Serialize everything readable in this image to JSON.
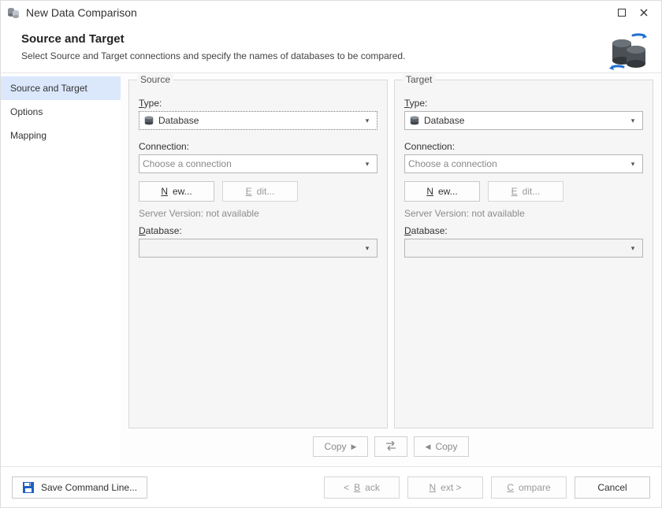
{
  "window": {
    "title": "New Data Comparison"
  },
  "header": {
    "title": "Source and Target",
    "subtitle": "Select Source and Target connections and specify the names of databases to be compared."
  },
  "sidebar": {
    "items": [
      {
        "label": "Source and Target",
        "active": true
      },
      {
        "label": "Options",
        "active": false
      },
      {
        "label": "Mapping",
        "active": false
      }
    ]
  },
  "panels": {
    "source": {
      "legend": "Source",
      "type_label_pre": "T",
      "type_label_post": "ype:",
      "type_value": "Database",
      "connection_label": "Connection:",
      "connection_placeholder": "Choose a connection",
      "new_label_pre": "N",
      "new_label_post": "ew...",
      "edit_label_pre": "E",
      "edit_label_post": "dit...",
      "server_version": "Server Version: not available",
      "database_label_pre": "D",
      "database_label_post": "atabase:"
    },
    "target": {
      "legend": "Target",
      "type_label_pre": "T",
      "type_label_post": "ype:",
      "type_value": "Database",
      "connection_label": "Connection:",
      "connection_placeholder": "Choose a connection",
      "new_label_pre": "N",
      "new_label_post": "ew...",
      "edit_label_pre": "E",
      "edit_label_post": "dit...",
      "server_version": "Server Version: not available",
      "database_label_pre": "D",
      "database_label_post": "atabase:"
    }
  },
  "midbar": {
    "copy_right": "Copy",
    "swap": "⇄",
    "copy_left": "Copy"
  },
  "footer": {
    "save_cmd": "Save Command Line...",
    "back_pre": "< ",
    "back_u": "B",
    "back_post": "ack",
    "next_u": "N",
    "next_post": "ext >",
    "compare_u": "C",
    "compare_post": "ompare",
    "cancel": "Cancel"
  }
}
